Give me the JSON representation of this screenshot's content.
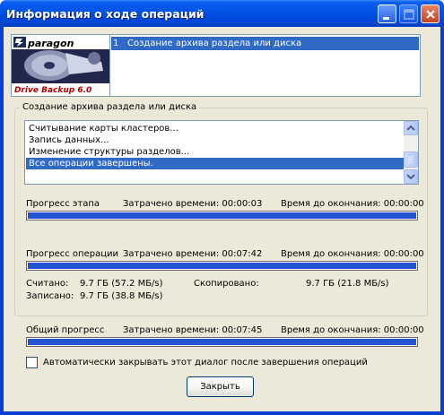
{
  "window": {
    "title": "Информация о ходе операций",
    "buttons": [
      "minimize",
      "maximize",
      "close"
    ]
  },
  "logo": {
    "brand": "paragon",
    "product": "Drive Backup 6.0"
  },
  "operations": [
    {
      "num": "1",
      "label": "Создание архива раздела или диска"
    }
  ],
  "group": {
    "title": "Создание архива раздела или диска",
    "log": [
      "Считывание карты кластеров...",
      "Запись данных...",
      "Изменение структуры разделов...",
      "Все операции завершены."
    ],
    "stage": {
      "label": "Прогресс этапа",
      "elapsed": "Затрачено времени: 00:00:03",
      "remaining": "Время до окончания: 00:00:00",
      "progress": 1.0
    },
    "operation": {
      "label": "Прогресс операции",
      "elapsed": "Затрачено времени: 00:07:42",
      "remaining": "Время до окончания: 00:00:00",
      "progress": 1.0
    },
    "stats": {
      "read_label": "Считано:",
      "read_value": "9.7 ГБ (57.2 МБ/s)",
      "written_label": "Записано:",
      "written_value": "9.7 ГБ (38.8 МБ/s)",
      "copied_label": "Скопировано:",
      "copied_value": "9.7 ГБ (21.8 МБ/s)"
    }
  },
  "overall": {
    "label": "Общий прогресс",
    "elapsed": "Затрачено времени: 00:07:45",
    "remaining": "Время до окончания: 00:00:00",
    "progress": 1.0
  },
  "autoclose": {
    "label": "Автоматически закрывать этот диалог после завершения операций",
    "checked": false
  },
  "close_button": "Закрыть",
  "colors": {
    "title_bar": "#0054e3",
    "selection": "#316ac5",
    "progress_fill": "#2353d1",
    "dialog_bg": "#ece9d8"
  }
}
